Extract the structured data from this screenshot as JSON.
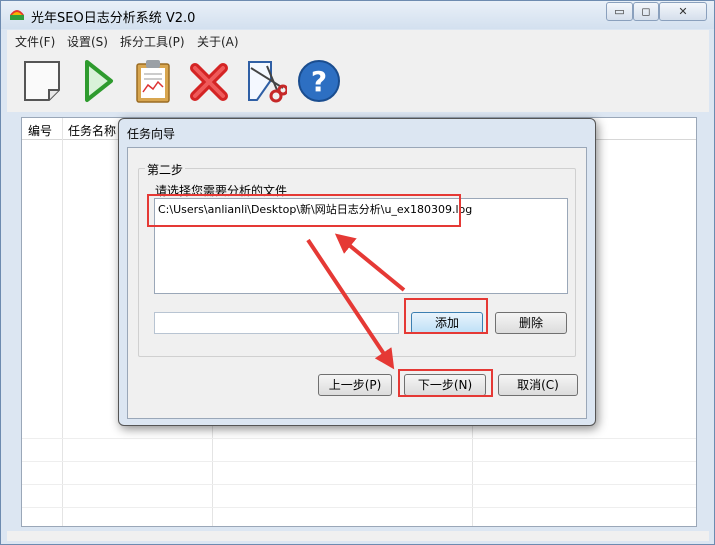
{
  "window": {
    "title": "光年SEO日志分析系统 V2.0",
    "controls": {
      "minimize": "▭",
      "maximize": "◻",
      "close": "✕"
    }
  },
  "menu": [
    "文件(F)",
    "设置(S)",
    "拆分工具(P)",
    "关于(A)"
  ],
  "toolbar": [
    "new-document-icon",
    "play-icon",
    "clipboard-icon",
    "delete-x-icon",
    "split-scissors-icon",
    "help-icon"
  ],
  "table": {
    "columns": [
      "编号",
      "任务名称"
    ]
  },
  "dialog": {
    "title": "任务向导",
    "step_title": "第二步",
    "file_label": "请选择您需要分析的文件",
    "files": [
      "C:\\Users\\anlianli\\Desktop\\新\\网站日志分析\\u_ex180309.log"
    ],
    "path_input_value": "",
    "buttons": {
      "add": "添加",
      "delete": "删除",
      "prev": "上一步(P)",
      "next": "下一步(N)",
      "cancel": "取消(C)"
    }
  },
  "colors": {
    "highlight": "#e53935",
    "window_frame": "#dce6f2",
    "primary_button": "#bde0f6"
  }
}
